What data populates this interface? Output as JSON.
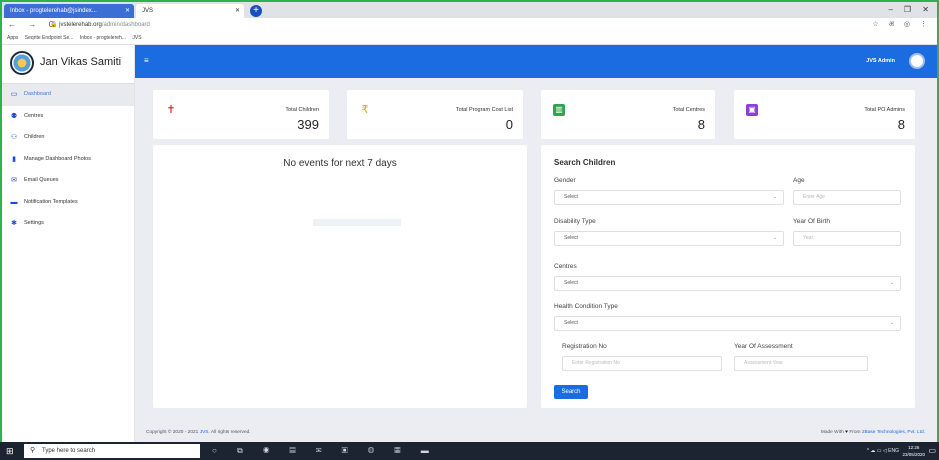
{
  "browser": {
    "tabs": [
      {
        "label": "Inbox - progtelerehab@jsindex...",
        "active": true
      },
      {
        "label": "JVS",
        "active": false
      }
    ],
    "url_host": "jvstelerehab.org",
    "url_path": "/admin/dashboard",
    "bookmarks": [
      "Apps",
      "Seqrite Endpoint Se...",
      "Inbox - progtelereh...",
      "JVS"
    ],
    "right_icons": "☆ अ ◎ ⋮"
  },
  "app": {
    "brand": "Jan Vikas Samiti",
    "admin_label": "JVS Admin",
    "accent_color": "#1b6ce0"
  },
  "sidebar": {
    "items": [
      {
        "label": "Dashboard",
        "icon": "monitor-icon",
        "glyph": "▭",
        "active": true
      },
      {
        "label": "Centres",
        "icon": "users-icon",
        "glyph": "⚉",
        "active": false
      },
      {
        "label": "Children",
        "icon": "child-icon",
        "glyph": "⚇",
        "active": false
      },
      {
        "label": "Manage Dashboard Photos",
        "icon": "file-icon",
        "glyph": "▮",
        "active": false
      },
      {
        "label": "Email Queues",
        "icon": "envelope-icon",
        "glyph": "✉",
        "active": false
      },
      {
        "label": "Notification Templates",
        "icon": "chat-icon",
        "glyph": "▬",
        "active": false
      },
      {
        "label": "Settings",
        "icon": "gear-icon",
        "glyph": "✱",
        "active": false
      }
    ]
  },
  "stats": [
    {
      "label": "Total Children",
      "value": "399",
      "icon": "child-figure-icon",
      "glyph": "✝",
      "color": "#d9343a"
    },
    {
      "label": "Total Program Cost List",
      "value": "0",
      "icon": "rupee-icon",
      "glyph": "₹",
      "color": "#e8a20c"
    },
    {
      "label": "Total Centres",
      "value": "8",
      "icon": "bar-chart-icon",
      "glyph": "▥",
      "color": "#2ea44f"
    },
    {
      "label": "Total PO Admins",
      "value": "8",
      "icon": "person-card-icon",
      "glyph": "▣",
      "color": "#8b3fd6"
    }
  ],
  "events": {
    "title": "No events for next 7 days"
  },
  "search": {
    "title": "Search Children",
    "gender_label": "Gender",
    "gender_value": "Select",
    "age_label": "Age",
    "age_placeholder": "Enter Age",
    "disability_label": "Disability Type",
    "disability_value": "Select",
    "yob_label": "Year Of Birth",
    "yob_placeholder": "Year",
    "centres_label": "Centres",
    "centres_value": "Select",
    "health_label": "Health Condition Type",
    "health_value": "Select",
    "regno_label": "Registration No",
    "regno_placeholder": "Enter Registration No",
    "yoa_label": "Year Of Assessment",
    "yoa_placeholder": "Assessment Year",
    "button": "Search"
  },
  "footer": {
    "left_prefix": "Copyright © 2020 - 2021",
    "left_brand": "JVS",
    "left_suffix": ". All rights reserved.",
    "right_prefix": "Made With",
    "right_mid": "From",
    "right_brand": "2Base Technologies, Pvt. Ltd."
  },
  "taskbar": {
    "search_placeholder": "Type here to search",
    "tray": "^ ☁ ▭ ◁ ENG",
    "time": "12:26",
    "date": "23/05/2020"
  }
}
